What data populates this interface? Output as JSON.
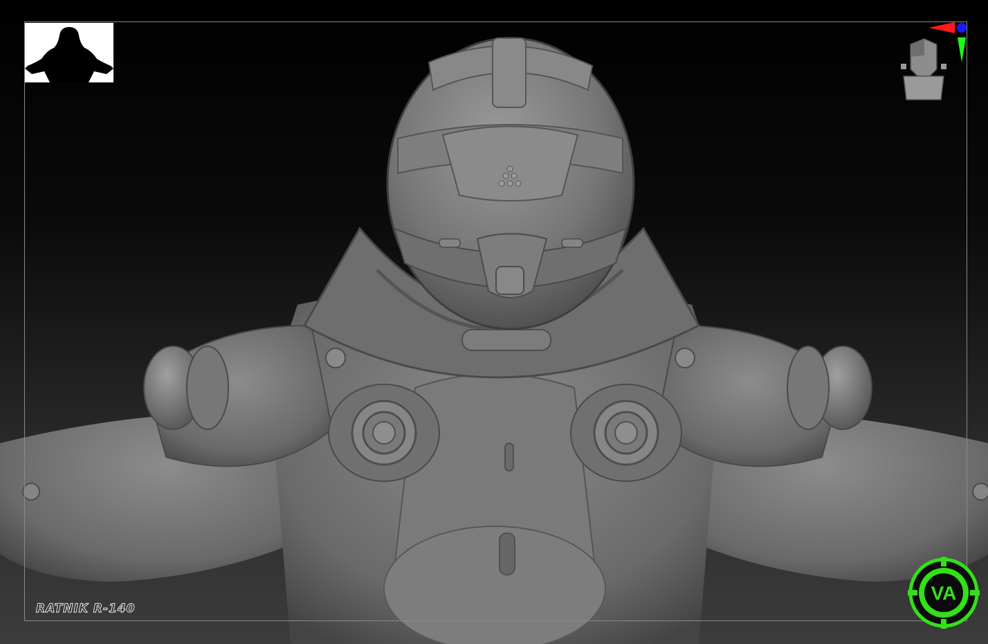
{
  "model_label": "RATNIK R-140",
  "logo_text": "VA",
  "icons": {
    "silhouette": "pose-silhouette-icon",
    "gizmo": "axis-orientation-icon",
    "logo": "brand-logo-icon"
  },
  "colors": {
    "background_top": "#000000",
    "background_bottom": "#3c3c3c",
    "model": "#808080",
    "frame": "#8a8a8a",
    "logo_green": "#33e01a",
    "axis_x": "#ff1a1a",
    "axis_y": "#1aff1a",
    "axis_z": "#1a1aff"
  }
}
